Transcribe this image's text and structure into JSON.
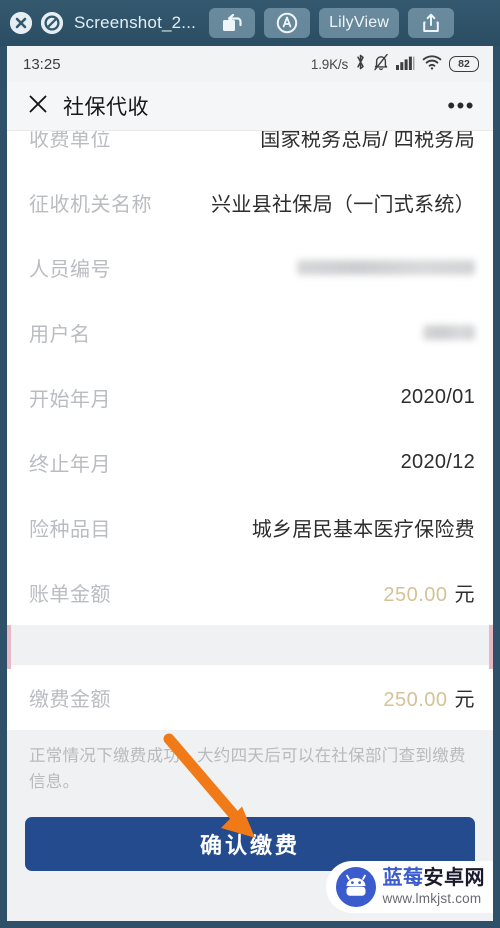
{
  "window": {
    "title": "Screenshot_2...",
    "close_icon": "close-circle-icon",
    "prohibit_icon": "no-entry-icon",
    "rotate_icon": "rotate-image-icon",
    "adjust_icon": "adjust-circle-a-icon",
    "app_name": "LilyView",
    "share_icon": "share-upload-icon",
    "chrome_color": "#2e5169"
  },
  "statusbar": {
    "time": "13:25",
    "net_speed": "1.9K/s",
    "bluetooth_icon": "bluetooth-icon",
    "mute_icon": "bell-muted-icon",
    "signal_icon": "signal-bars-icon",
    "wifi_icon": "wifi-icon",
    "battery": "82"
  },
  "header": {
    "close_icon": "close-x-icon",
    "title": "社保代收",
    "more_icon": "more-dots-icon"
  },
  "form": {
    "rows": [
      {
        "label": "收费单位",
        "value": "国家税务总局/  四税务局",
        "redacted": false,
        "money": false
      },
      {
        "label": "征收机关名称",
        "value": "兴业县社保局（一门式系统）",
        "redacted": false,
        "money": false
      },
      {
        "label": "人员编号",
        "value": "",
        "redacted": true,
        "money": false
      },
      {
        "label": "用户名",
        "value": "",
        "redacted": true,
        "money": false
      },
      {
        "label": "开始年月",
        "value": "2020/01",
        "redacted": false,
        "money": false
      },
      {
        "label": "终止年月",
        "value": "2020/12",
        "redacted": false,
        "money": false
      },
      {
        "label": "险种品目",
        "value": "城乡居民基本医疗保险费",
        "redacted": false,
        "money": false
      },
      {
        "label": "账单金额",
        "value": "250.00",
        "unit": "元",
        "redacted": false,
        "money": true
      }
    ]
  },
  "payment": {
    "label": "缴费金额",
    "amount": "250.00",
    "unit": "元",
    "amount_color": "#d6c296"
  },
  "hint": "正常情况下缴费成功，大约四天后可以在社保部门查到缴费信息。",
  "confirm_button": {
    "label": "确认缴费",
    "color": "#234b8e"
  },
  "annotation": {
    "arrow_color": "#f07a17"
  },
  "watermark": {
    "brand_blue": "蓝莓",
    "brand_dark": "安卓网",
    "url": "www.lmkjst.com",
    "logo_icon": "android-robot-icon"
  }
}
